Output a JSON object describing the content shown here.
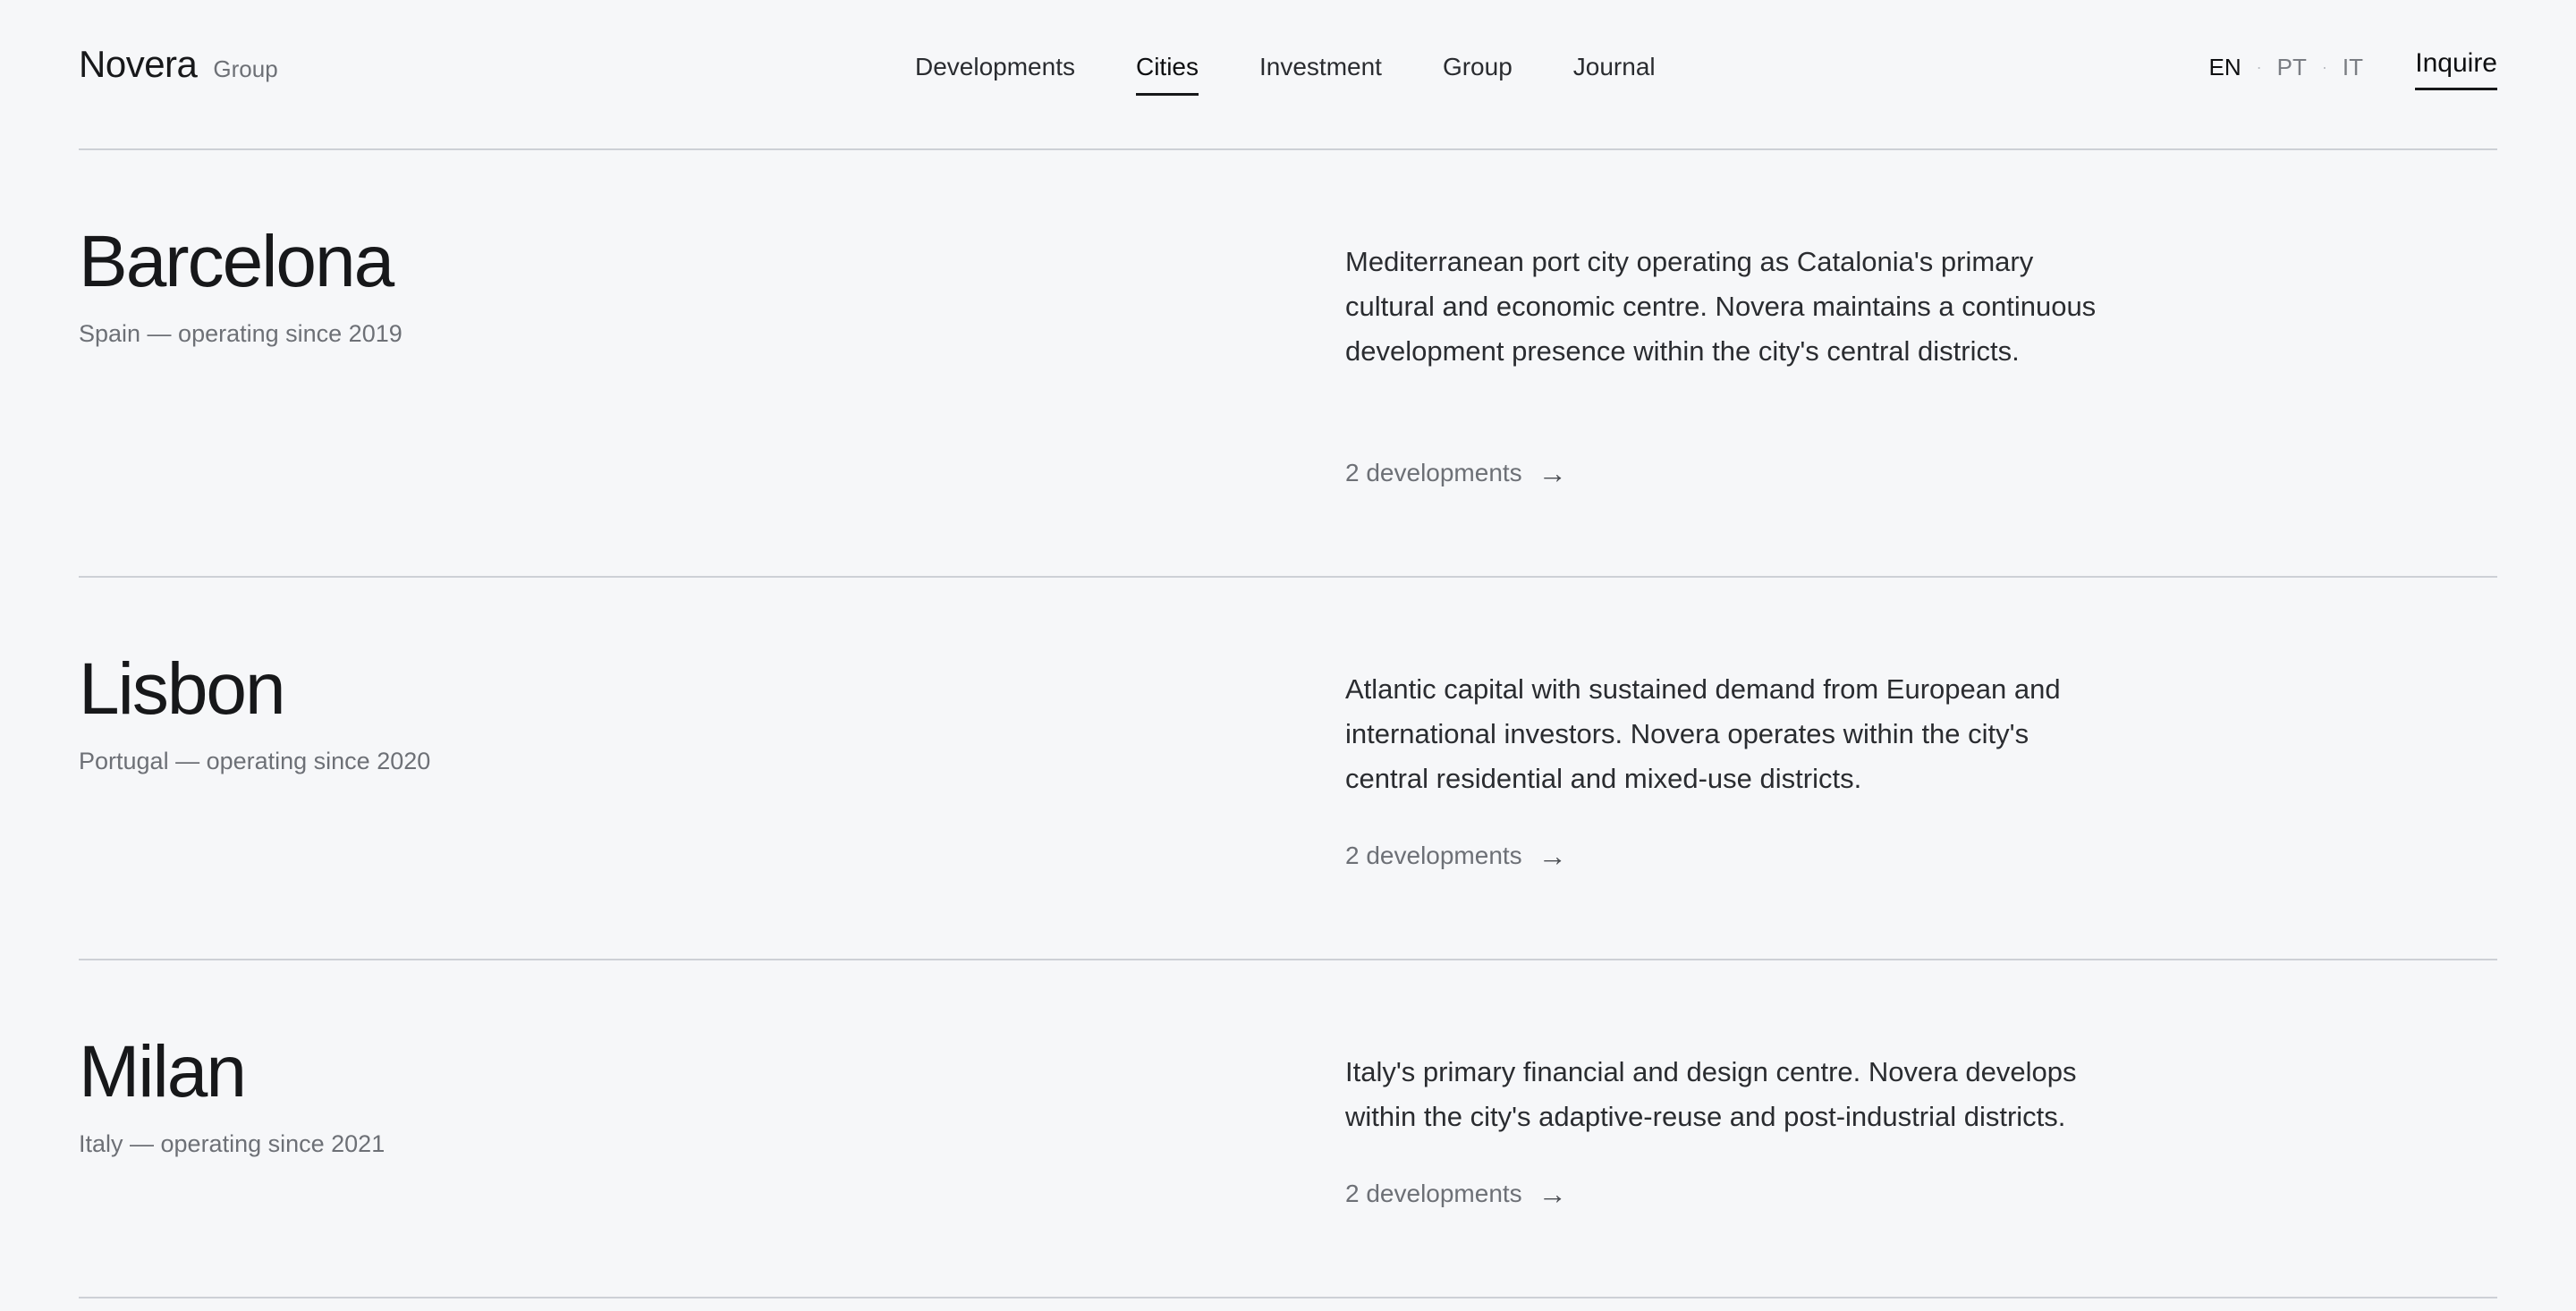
{
  "brand": {
    "name": "Novera",
    "sub": "Group"
  },
  "nav": {
    "items": [
      {
        "label": "Developments",
        "active": false
      },
      {
        "label": "Cities",
        "active": true
      },
      {
        "label": "Investment",
        "active": false
      },
      {
        "label": "Group",
        "active": false
      },
      {
        "label": "Journal",
        "active": false
      }
    ]
  },
  "languages": {
    "items": [
      {
        "label": "EN",
        "active": true
      },
      {
        "label": "PT",
        "active": false
      },
      {
        "label": "IT",
        "active": false
      }
    ],
    "separator": "·"
  },
  "inquire_label": "Inquire",
  "cities": [
    {
      "name": "Barcelona",
      "meta": "Spain — operating since 2019",
      "description": "Mediterranean port city operating as Catalonia's primary cultural and economic centre. Novera maintains a continuous development presence within the city's central districts.",
      "link_label": "2 developments",
      "arrow": "→"
    },
    {
      "name": "Lisbon",
      "meta": "Portugal — operating since 2020",
      "description": "Atlantic capital with sustained demand from European and international investors. Novera operates within the city's central residential and mixed-use districts.",
      "link_label": "2 developments",
      "arrow": "→"
    },
    {
      "name": "Milan",
      "meta": "Italy — operating since 2021",
      "description": "Italy's primary financial and design centre. Novera develops within the city's adaptive-reuse and post-industrial districts.",
      "link_label": "2 developments",
      "arrow": "→"
    }
  ]
}
